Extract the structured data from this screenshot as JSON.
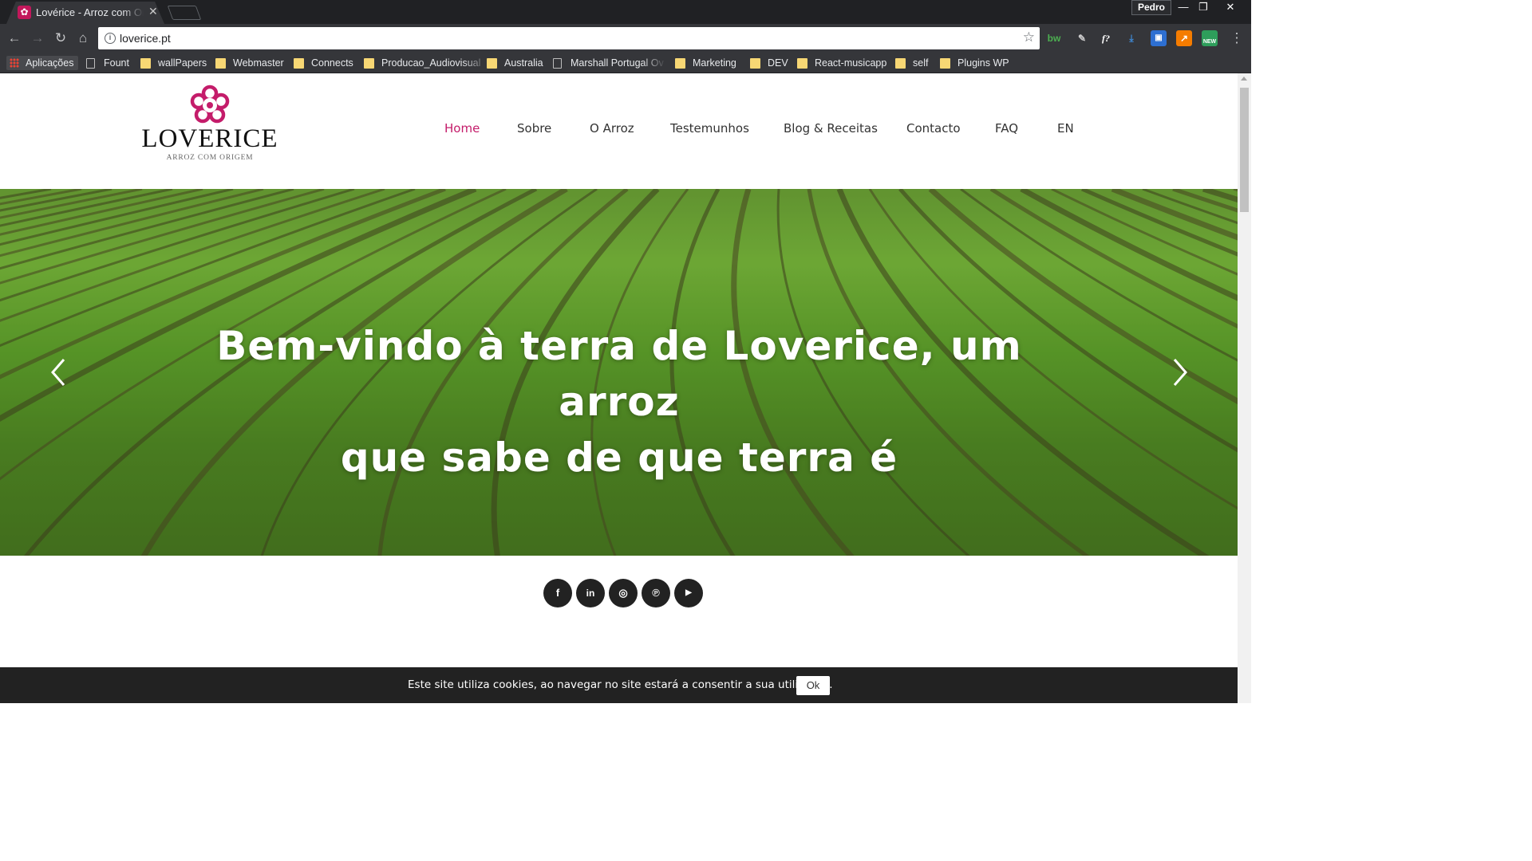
{
  "browser": {
    "tab_title": "Lovérice - Arroz com Origem",
    "profile_name": "Pedro",
    "url": "loverice.pt",
    "bookmarks": [
      {
        "label": "Aplicações",
        "kind": "apps"
      },
      {
        "label": "Fount",
        "kind": "page"
      },
      {
        "label": "wallPapers",
        "kind": "folder"
      },
      {
        "label": "Webmaster",
        "kind": "folder"
      },
      {
        "label": "Connects",
        "kind": "folder"
      },
      {
        "label": "Producao_Audiovisual",
        "kind": "folder"
      },
      {
        "label": "Australia",
        "kind": "folder"
      },
      {
        "label": "Marshall Portugal Ov",
        "kind": "page"
      },
      {
        "label": "Marketing",
        "kind": "folder"
      },
      {
        "label": "DEV",
        "kind": "folder"
      },
      {
        "label": "React-musicapp",
        "kind": "folder"
      },
      {
        "label": "self",
        "kind": "folder"
      },
      {
        "label": "Plugins WP",
        "kind": "folder"
      }
    ],
    "extensions": [
      "bw",
      "f?",
      "NEW"
    ]
  },
  "site": {
    "logo_word": "LOVERICE",
    "logo_tagline": "ARROZ COM ORIGEM",
    "brand_color": "#c41c6a",
    "nav": [
      "Home",
      "Sobre",
      "O Arroz",
      "Testemunhos",
      "Blog & Receitas",
      "Contacto",
      "FAQ",
      "EN"
    ],
    "active_nav": "Home",
    "hero": {
      "line1": "Bem-vindo à terra de Loverice, um arroz",
      "line2": "que sabe de que terra é"
    },
    "social_icons": [
      "facebook-icon",
      "linkedin-icon",
      "instagram-icon",
      "pinterest-icon",
      "youtube-icon"
    ],
    "social_glyphs": [
      "f",
      "in",
      "◎",
      "℗",
      "▶"
    ],
    "cookie": {
      "text": "Este site utiliza cookies, ao navegar no site estará a consentir a sua utilização.",
      "button": "Ok"
    }
  }
}
